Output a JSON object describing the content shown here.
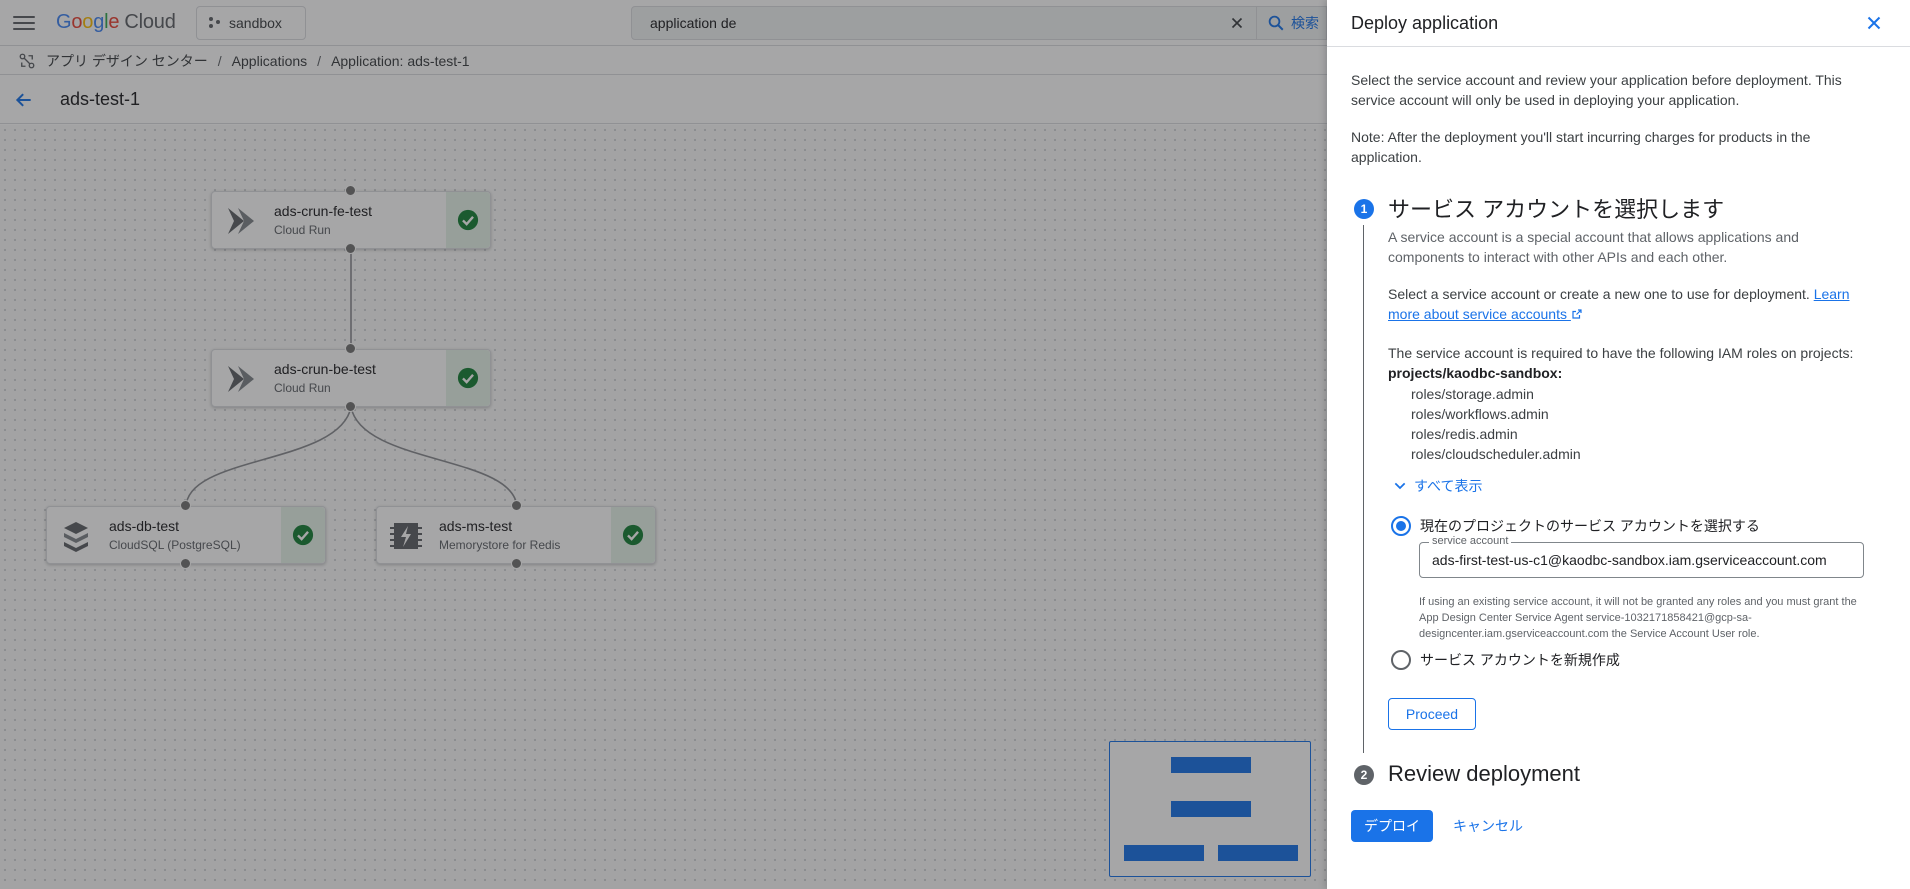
{
  "topbar": {
    "logo_google": "Google",
    "logo_cloud": "Cloud",
    "project": "sandbox",
    "search_value": "application de",
    "search_button": "検索"
  },
  "breadcrumb": {
    "items": [
      "アプリ デザイン センター",
      "Applications",
      "Application: ads-test-1"
    ],
    "separator": "/"
  },
  "page": {
    "title": "ads-test-1"
  },
  "canvas": {
    "nodes": [
      {
        "name": "ads-crun-fe-test",
        "type": "Cloud Run",
        "icon": "cloud-run-icon",
        "status": "success-check-icon"
      },
      {
        "name": "ads-crun-be-test",
        "type": "Cloud Run",
        "icon": "cloud-run-icon",
        "status": "success-check-icon"
      },
      {
        "name": "ads-db-test",
        "type": "CloudSQL (PostgreSQL)",
        "icon": "cloudsql-icon",
        "status": "success-check-icon"
      },
      {
        "name": "ads-ms-test",
        "type": "Memorystore for Redis",
        "icon": "memorystore-icon",
        "status": "success-check-icon"
      }
    ]
  },
  "panel": {
    "title": "Deploy application",
    "intro": "Select the service account and review your application before deployment. This service account will only be used in deploying your application.",
    "note": "Note: After the deployment you'll start incurring charges for products in the application.",
    "step1": {
      "number": "1",
      "title": "サービス アカウントを選択します",
      "desc": "A service account is a special account that allows applications and components to interact with other APIs and each other.",
      "select_text": "Select a service account or create a new one to use for deployment.",
      "learn_more": "Learn more about service accounts",
      "required_text": "The service account is required to have the following IAM roles on projects:",
      "project": "projects/kaodbc-sandbox:",
      "roles": [
        "roles/storage.admin",
        "roles/workflows.admin",
        "roles/redis.admin",
        "roles/cloudscheduler.admin"
      ],
      "show_all": "すべて表示",
      "option_existing": "現在のプロジェクトのサービス アカウントを選択する",
      "field_label": "service account",
      "field_value": "ads-first-test-us-c1@kaodbc-sandbox.iam.gserviceaccount.com",
      "hint": "If using an existing service account, it will not be granted any roles and you must grant the App Design Center Service Agent service-1032171858421@gcp-sa-designcenter.iam.gserviceaccount.com the Service Account User role.",
      "option_new": "サービス アカウントを新規作成",
      "proceed": "Proceed"
    },
    "step2": {
      "number": "2",
      "title": "Review deployment"
    },
    "deploy": "デプロイ",
    "cancel": "キャンセル"
  },
  "colors": {
    "accent": "#1a73e8",
    "success": "#188038",
    "success_bg": "#e6f4ea"
  }
}
